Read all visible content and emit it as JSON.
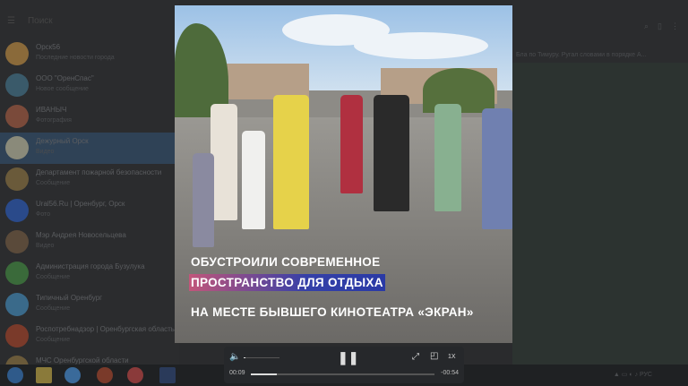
{
  "sidebar": {
    "search_placeholder": "Поиск",
    "chats": [
      {
        "name": "Орск56",
        "preview": "Последние новости города",
        "color": "#8a6a3a"
      },
      {
        "name": "ООО \"ОренСпас\"",
        "preview": "Новое сообщение",
        "color": "#3a5a6a"
      },
      {
        "name": "ИВАНЫЧ",
        "preview": "Фотография",
        "color": "#7a4a3a"
      },
      {
        "name": "Дежурный Орск",
        "preview": "Видео",
        "color": "#8a8a7a"
      },
      {
        "name": "Департамент пожарной безопасности",
        "preview": "Сообщение",
        "color": "#6a5a3a"
      },
      {
        "name": "Ural56.Ru | Оренбург, Орск",
        "preview": "Фото",
        "color": "#2a4a8a"
      },
      {
        "name": "Мэр Андрея Новосельцева",
        "preview": "Видео",
        "color": "#5a4a3a"
      },
      {
        "name": "Администрация города Бузулука",
        "preview": "Сообщение",
        "color": "#3a6a3a"
      },
      {
        "name": "Типичный Оренбург",
        "preview": "Сообщение",
        "color": "#3a6a8a"
      },
      {
        "name": "Роспотребнадзор | Оренбургская область",
        "preview": "Сообщение",
        "color": "#7a3a2a"
      },
      {
        "name": "МЧС Оренбургской области",
        "preview": "",
        "color": "#6a5a3a"
      }
    ]
  },
  "right": {
    "pinned": "Бла по Тимуру. Ругал словами в порядке А..."
  },
  "video": {
    "caption": [
      "ОБУСТРОИЛИ СОВРЕМЕННОЕ",
      "ПРОСТРАНСТВО ДЛЯ ОТДЫХА",
      "НА МЕСТЕ БЫВШЕГО КИНОТЕАТРА «ЭКРАН»"
    ]
  },
  "player": {
    "elapsed": "00:09",
    "remaining": "-00:54",
    "speed": "1X",
    "progress": 0.14,
    "volume": 0.05
  }
}
